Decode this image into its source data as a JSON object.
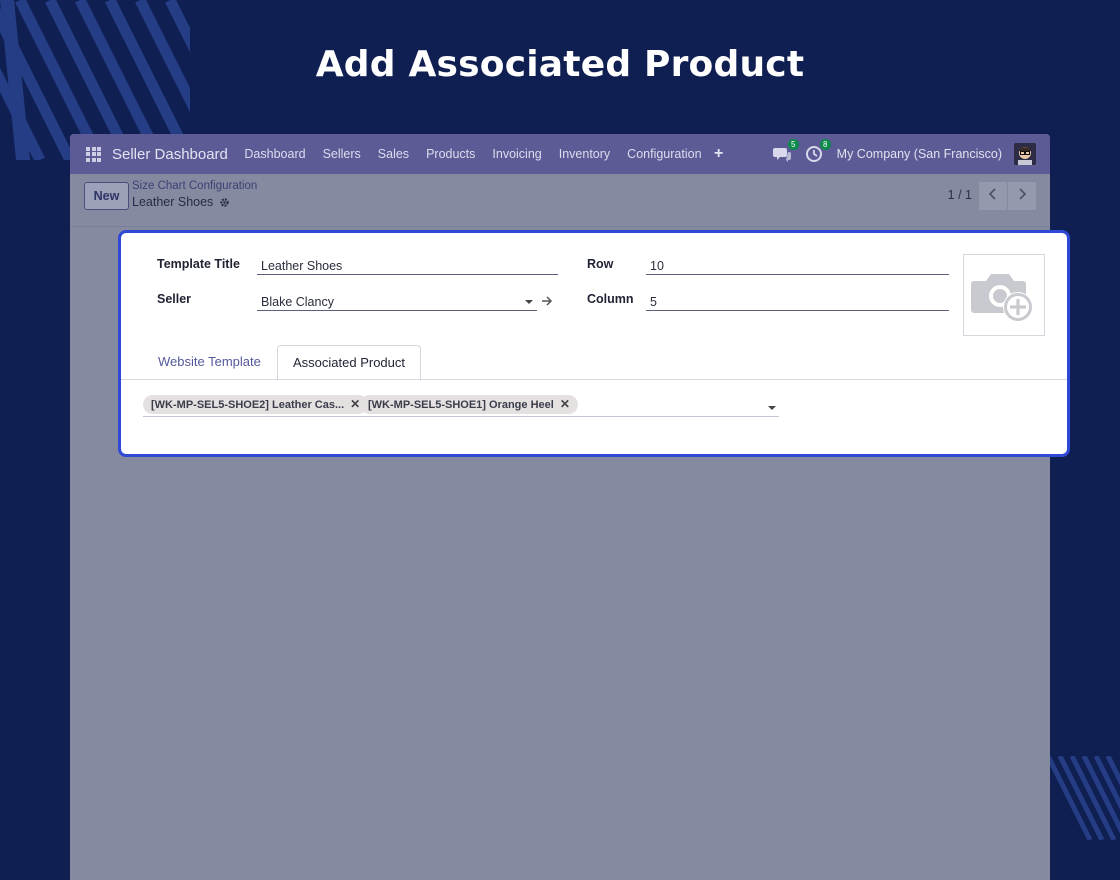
{
  "headline": "Add Associated Product",
  "navbar": {
    "brand": "Seller Dashboard",
    "menu": [
      "Dashboard",
      "Sellers",
      "Sales",
      "Products",
      "Invoicing",
      "Inventory",
      "Configuration"
    ],
    "plus": "+",
    "messages_count": "5",
    "activities_count": "8",
    "company": "My Company (San Francisco)"
  },
  "control": {
    "new_label": "New",
    "breadcrumb_parent": "Size Chart Configuration",
    "breadcrumb_current": "Leather Shoes",
    "pager": "1 / 1"
  },
  "form": {
    "template_title_label": "Template Title",
    "template_title_value": "Leather Shoes",
    "seller_label": "Seller",
    "seller_value": "Blake Clancy",
    "row_label": "Row",
    "row_value": "10",
    "column_label": "Column",
    "column_value": "5"
  },
  "tabs": [
    "Website Template",
    "Associated Product"
  ],
  "active_tab": "Associated Product",
  "associated_products": [
    "[WK-MP-SEL5-SHOE2] Leather Cas...",
    "[WK-MP-SEL5-SHOE1] Orange Heel"
  ],
  "colors": {
    "background": "#101f52",
    "navbar": "#5d5b96",
    "highlight_border": "#2f48d6",
    "badge": "#0c8a4a"
  }
}
